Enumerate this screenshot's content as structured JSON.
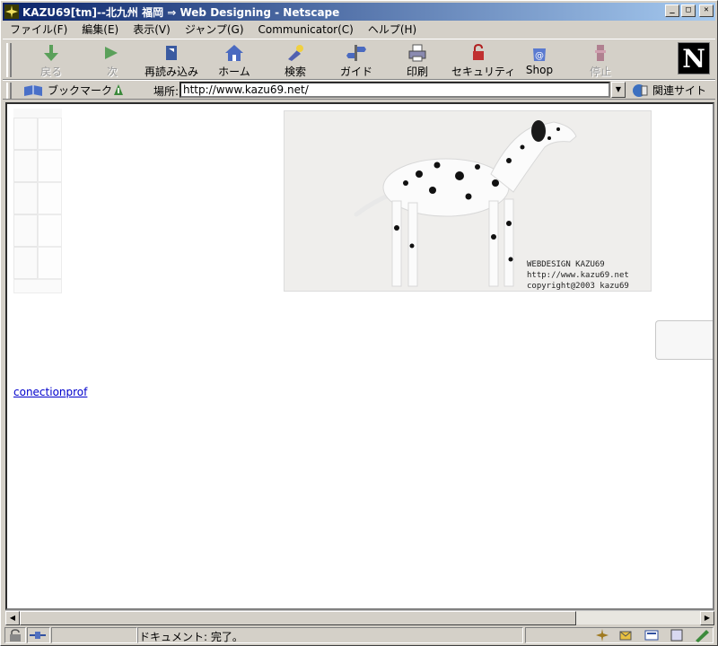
{
  "window": {
    "title": "KAZU69[tm]--北九州 福岡 ⇒ Web Designing - Netscape"
  },
  "menu": [
    "ファイル(F)",
    "編集(E)",
    "表示(V)",
    "ジャンプ(G)",
    "Communicator(C)",
    "ヘルプ(H)"
  ],
  "toolbar": {
    "back": "戻る",
    "forward": "次",
    "reload": "再読み込み",
    "home": "ホーム",
    "search": "検索",
    "guide": "ガイド",
    "print": "印刷",
    "security": "セキュリティ",
    "shop": "Shop",
    "stop": "停止"
  },
  "location": {
    "bookmarks_label": "ブックマーク",
    "address_label": "場所:",
    "url": "http://www.kazu69.net/",
    "related_label": "関連サイト"
  },
  "page": {
    "banner_lines": [
      "WEBDESIGN KAZU69",
      "http://www.kazu69.net",
      "copyright@2003 kazu69"
    ],
    "link_text": "conectionprof"
  },
  "status": {
    "text": "ドキュメント: 完了。"
  },
  "colors": {
    "titlebar_start": "#0a246a",
    "titlebar_end": "#a6caf0",
    "link": "#0000cc",
    "chrome": "#d4d0c8"
  },
  "icons": [
    "netscape-app-icon",
    "back-arrow-icon",
    "forward-arrow-icon",
    "reload-icon",
    "home-icon",
    "search-icon",
    "guide-icon",
    "print-icon",
    "security-lock-icon",
    "shop-icon",
    "stop-icon",
    "netscape-n-logo",
    "bookmarks-icon",
    "location-icon",
    "related-sites-icon"
  ]
}
